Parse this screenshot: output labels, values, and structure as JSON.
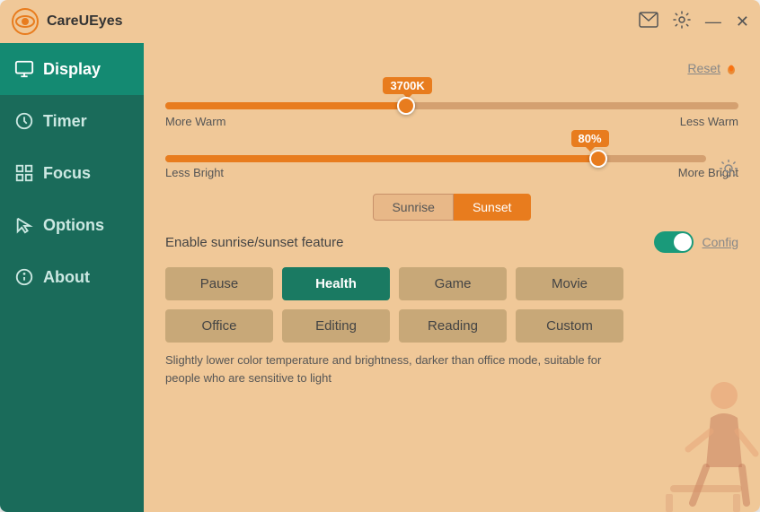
{
  "titleBar": {
    "appName": "CareUEyes",
    "controls": [
      "email-icon",
      "settings-icon",
      "minimize-icon",
      "close-icon"
    ]
  },
  "sidebar": {
    "items": [
      {
        "id": "display",
        "label": "Display",
        "icon": "monitor-icon",
        "active": true
      },
      {
        "id": "timer",
        "label": "Timer",
        "icon": "clock-icon",
        "active": false
      },
      {
        "id": "focus",
        "label": "Focus",
        "icon": "grid-icon",
        "active": false
      },
      {
        "id": "options",
        "label": "Options",
        "icon": "cursor-icon",
        "active": false
      },
      {
        "id": "about",
        "label": "About",
        "icon": "info-icon",
        "active": false
      }
    ]
  },
  "content": {
    "resetButton": "Reset",
    "temperatureSlider": {
      "value": "3700K",
      "percent": 42,
      "labelLeft": "More Warm",
      "labelRight": "Less Warm"
    },
    "brightnessSlider": {
      "value": "80%",
      "percent": 80,
      "labelLeft": "Less Bright",
      "labelRight": "More Bright"
    },
    "sunriseSunset": {
      "tabs": [
        "Sunrise",
        "Sunset"
      ],
      "activeTab": "Sunset"
    },
    "toggle": {
      "label": "Enable sunrise/sunset feature",
      "enabled": true
    },
    "configLink": "Config",
    "modeButtons": {
      "row1": [
        {
          "id": "pause",
          "label": "Pause",
          "active": false
        },
        {
          "id": "health",
          "label": "Health",
          "active": true
        },
        {
          "id": "game",
          "label": "Game",
          "active": false
        },
        {
          "id": "movie",
          "label": "Movie",
          "active": false
        }
      ],
      "row2": [
        {
          "id": "office",
          "label": "Office",
          "active": false
        },
        {
          "id": "editing",
          "label": "Editing",
          "active": false
        },
        {
          "id": "reading",
          "label": "Reading",
          "active": false
        },
        {
          "id": "custom",
          "label": "Custom",
          "active": false
        }
      ]
    },
    "description": "Slightly lower color temperature and brightness, darker than office mode, suitable for people who are sensitive to light"
  }
}
